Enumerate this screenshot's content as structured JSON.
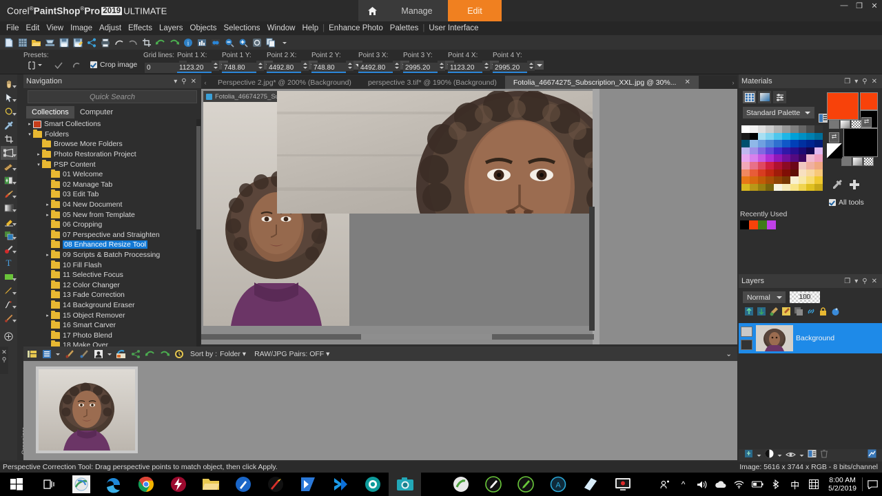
{
  "app": {
    "brand_prefix": "Corel",
    "brand_main": "PaintShop",
    "brand_pro": "Pro",
    "brand_year": "2019",
    "brand_edition": "ULTIMATE"
  },
  "top_tabs": [
    {
      "name": "home",
      "label": "⌂"
    },
    {
      "name": "manage",
      "label": "Manage"
    },
    {
      "name": "edit",
      "label": "Edit"
    }
  ],
  "window_controls": [
    "—",
    "❐",
    "✕"
  ],
  "menubar": {
    "items": [
      "File",
      "Edit",
      "View",
      "Image",
      "Adjust",
      "Effects",
      "Layers",
      "Objects",
      "Selections",
      "Window",
      "Help"
    ],
    "items2": [
      "Enhance Photo",
      "Palettes"
    ],
    "items3": [
      "User Interface"
    ]
  },
  "toolbar_icons": [
    "new-image-icon",
    "new-from-template-icon",
    "open-icon",
    "scanner-icon",
    "save-icon",
    "save-as-icon",
    "share-icon",
    "print-icon",
    "undo-icon",
    "redo-icon",
    "crop-icon",
    "rotate-left-icon",
    "rotate-right-icon",
    "info-icon",
    "histogram-icon",
    "color-icon",
    "zoom-out-icon",
    "zoom-in-icon",
    "fit-window-icon",
    "duplicate-icon"
  ],
  "options_bar": {
    "presets_label": "Presets:",
    "crop_image_label": "Crop image",
    "crop_image_checked": true,
    "fields": [
      {
        "label": "Grid lines:",
        "value": "0",
        "underline": false
      },
      {
        "label": "Point 1 X:",
        "value": "1123.20",
        "underline": true
      },
      {
        "label": "Point 1 Y:",
        "value": "748.80",
        "underline": true
      },
      {
        "label": "Point 2 X:",
        "value": "4492.80",
        "underline": true
      },
      {
        "label": "Point 2 Y:",
        "value": "748.80",
        "underline": true
      },
      {
        "label": "Point 3 X:",
        "value": "4492.80",
        "underline": true
      },
      {
        "label": "Point 3 Y:",
        "value": "2995.20",
        "underline": true
      },
      {
        "label": "Point 4 X:",
        "value": "1123.20",
        "underline": true
      },
      {
        "label": "Point 4 Y:",
        "value": "2995.20",
        "underline": true
      }
    ]
  },
  "tools": [
    {
      "name": "pan-tool",
      "glyph": "✋",
      "selected": false,
      "arrow": true
    },
    {
      "name": "pick-tool",
      "glyph": "➤",
      "selected": false,
      "arrow": true
    },
    {
      "name": "selection-tool",
      "glyph": "⬭",
      "selected": false,
      "arrow": true
    },
    {
      "name": "dropper-tool",
      "glyph": "✒",
      "selected": false,
      "arrow": false
    },
    {
      "name": "crop-tool",
      "glyph": "⧉",
      "selected": false,
      "arrow": false
    },
    {
      "name": "perspective-correction-tool",
      "glyph": "▱",
      "selected": true,
      "arrow": true
    },
    {
      "name": "straighten-tool",
      "glyph": "╱",
      "selected": false,
      "arrow": true
    },
    {
      "name": "fill-flash-tool",
      "glyph": "◨",
      "selected": false,
      "arrow": true
    },
    {
      "name": "paint-brush-tool",
      "glyph": "✎",
      "selected": false,
      "arrow": true
    },
    {
      "name": "gradient-tool",
      "glyph": "▣",
      "selected": false,
      "arrow": true
    },
    {
      "name": "eraser-tool",
      "glyph": "▬",
      "selected": false,
      "arrow": true
    },
    {
      "name": "clone-tool",
      "glyph": "⧉",
      "selected": false,
      "arrow": true
    },
    {
      "name": "retouch-tool",
      "glyph": "●",
      "selected": false,
      "arrow": true
    },
    {
      "name": "text-tool",
      "glyph": "T",
      "selected": false,
      "arrow": false
    },
    {
      "name": "shape-tool",
      "glyph": "▬",
      "selected": false,
      "arrow": true
    },
    {
      "name": "pen-tool",
      "glyph": "✐",
      "selected": false,
      "arrow": true
    },
    {
      "name": "warp-brush-tool",
      "glyph": "⌇",
      "selected": false,
      "arrow": true
    },
    {
      "name": "mesh-warp-tool",
      "glyph": "⌘",
      "selected": false,
      "arrow": true
    }
  ],
  "navigation_panel": {
    "title": "Navigation",
    "search_placeholder": "Quick Search",
    "tabs": [
      {
        "label": "Collections",
        "active": true
      },
      {
        "label": "Computer",
        "active": false
      }
    ],
    "tree": [
      {
        "label": "Smart Collections",
        "indent": 0,
        "expander": "▸",
        "type": "smart"
      },
      {
        "label": "Folders",
        "indent": 0,
        "expander": "▾",
        "type": "folder"
      },
      {
        "label": "Browse More Folders",
        "indent": 1,
        "expander": "",
        "type": "folder"
      },
      {
        "label": "Photo Restoration Project",
        "indent": 1,
        "expander": "▸",
        "type": "folder"
      },
      {
        "label": "PSP Content",
        "indent": 1,
        "expander": "▾",
        "type": "folder"
      },
      {
        "label": "01 Welcome",
        "indent": 2,
        "expander": "",
        "type": "folder"
      },
      {
        "label": "02 Manage Tab",
        "indent": 2,
        "expander": "",
        "type": "folder"
      },
      {
        "label": "03 Edit Tab",
        "indent": 2,
        "expander": "",
        "type": "folder"
      },
      {
        "label": "04 New Document",
        "indent": 2,
        "expander": "▸",
        "type": "folder"
      },
      {
        "label": "05 New from Template",
        "indent": 2,
        "expander": "▸",
        "type": "folder"
      },
      {
        "label": "06 Cropping",
        "indent": 2,
        "expander": "",
        "type": "folder"
      },
      {
        "label": "07 Perspective and Straighten",
        "indent": 2,
        "expander": "",
        "type": "folder"
      },
      {
        "label": "08 Enhanced Resize Tool",
        "indent": 2,
        "expander": "",
        "type": "folder",
        "selected": true
      },
      {
        "label": "09 Scripts & Batch Processing",
        "indent": 2,
        "expander": "▸",
        "type": "folder"
      },
      {
        "label": "10 Fill Flash",
        "indent": 2,
        "expander": "",
        "type": "folder"
      },
      {
        "label": "11 Selective Focus",
        "indent": 2,
        "expander": "",
        "type": "folder"
      },
      {
        "label": "12 Color Changer",
        "indent": 2,
        "expander": "",
        "type": "folder"
      },
      {
        "label": "13 Fade Correction",
        "indent": 2,
        "expander": "",
        "type": "folder"
      },
      {
        "label": "14 Background Eraser",
        "indent": 2,
        "expander": "",
        "type": "folder"
      },
      {
        "label": "15 Object Remover",
        "indent": 2,
        "expander": "▸",
        "type": "folder"
      },
      {
        "label": "16 Smart Carver",
        "indent": 2,
        "expander": "",
        "type": "folder"
      },
      {
        "label": "17 Photo Blend",
        "indent": 2,
        "expander": "",
        "type": "folder"
      },
      {
        "label": "18 Make Over",
        "indent": 2,
        "expander": "",
        "type": "folder"
      }
    ]
  },
  "document_tabs": [
    {
      "label": "Perspective 2.jpg* @ 200% (Background)",
      "active": false
    },
    {
      "label": "perspective 3.tif* @ 190% (Background)",
      "active": false
    },
    {
      "label": "Fotolia_46674275_Subscription_XXL.jpg @  30%...",
      "active": true,
      "close": "✕"
    }
  ],
  "image_window": {
    "title": "Fotolia_46674275_Su"
  },
  "organizer": {
    "sort_by_label": "Sort by :",
    "sort_by_value": "Folder",
    "raw_jpg_label": "RAW/JPG Pairs: OFF",
    "vertical_label": "Organizer",
    "icons": [
      "folder-view-icon",
      "list-view-icon",
      "tag-icon",
      "tag-remove-icon",
      "people-icon",
      "places-icon",
      "share-icon",
      "rotate-left-icon",
      "rotate-right-icon",
      "recent-icon"
    ]
  },
  "materials_panel": {
    "title": "Materials",
    "header_icons": [
      "restore-icon",
      "chevron-down-icon",
      "pin-icon",
      "close-icon"
    ],
    "mode_buttons": [
      "palette-mode-icon",
      "gradient-mode-icon",
      "sliders-mode-icon"
    ],
    "palette_label": "Standard Palette",
    "all_tools_label": "All tools",
    "all_tools_checked": true,
    "recently_used_label": "Recently Used",
    "recently_used_colors": [
      "#000000",
      "#f8420a",
      "#3f7a18",
      "#c040e8"
    ],
    "foreground_color": "#f8420a",
    "background_color": "#000000"
  },
  "layers_panel": {
    "title": "Layers",
    "header_icons": [
      "restore-icon",
      "chevron-down-icon",
      "pin-icon",
      "close-icon"
    ],
    "blend_mode": "Normal",
    "opacity": "100",
    "tool_icons": [
      "new-raster-layer-icon",
      "new-vector-layer-icon",
      "new-art-media-icon",
      "new-mask-layer-icon",
      "merge-icon",
      "link-icon",
      "lock-icon",
      "effects-icon"
    ],
    "layer": {
      "name": "Background",
      "selected": true
    },
    "footer_icons": [
      "new-layer-icon",
      "mask-icon",
      "visibility-icon",
      "properties-icon",
      "delete-icon",
      "settings-icon"
    ]
  },
  "status_bar": {
    "message": "Perspective Correction Tool: Drag perspective points to match object, then click Apply.",
    "image_info": "Image: 5616 x 3744 x RGB - 8 bits/channel"
  },
  "taskbar": {
    "items": [
      {
        "name": "start-button"
      },
      {
        "name": "task-view-button"
      },
      {
        "name": "paintshop-pro-taskbar-icon",
        "active": false,
        "underline": false
      },
      {
        "name": "edge-taskbar-icon",
        "underline": false
      },
      {
        "name": "chrome-taskbar-icon",
        "underline": true
      },
      {
        "name": "flash-taskbar-icon",
        "underline": false
      },
      {
        "name": "file-explorer-taskbar-icon",
        "underline": true
      },
      {
        "name": "corel-draw-taskbar-icon",
        "underline": false
      },
      {
        "name": "corel-photo-paint-taskbar-icon",
        "underline": false
      },
      {
        "name": "powershell-taskbar-icon",
        "underline": false
      },
      {
        "name": "terminal-taskbar-icon",
        "underline": false
      },
      {
        "name": "camtasia-taskbar-icon",
        "underline": false
      },
      {
        "name": "camera-taskbar-icon",
        "active": true,
        "underline": false
      },
      {
        "name": "aftershot-taskbar-icon",
        "underline": false
      },
      {
        "name": "painter-taskbar-icon",
        "underline": false
      },
      {
        "name": "painter-essentials-taskbar-icon",
        "underline": false
      },
      {
        "name": "aftereffects-taskbar-icon",
        "underline": false
      },
      {
        "name": "notebook-taskbar-icon",
        "underline": true
      },
      {
        "name": "screen-recorder-taskbar-icon",
        "underline": true
      }
    ],
    "tray_icons": [
      "show-hidden-icons",
      "volume-icon",
      "onedrive-icon",
      "network-icon",
      "battery-icon",
      "bluetooth-icon",
      "ime-icon",
      "ime-mode-icon"
    ],
    "people_icon": "people-icon",
    "clock_time": "8:00 AM",
    "clock_date": "5/2/2019",
    "action_center": "notification-icon"
  },
  "colors": {
    "accent_orange": "#f08020",
    "selection_blue": "#1278d4",
    "layer_blue": "#1e8ae8",
    "panel_bg": "#2e2e2e",
    "titlebar_bg": "#2b2b2b",
    "canvas_bg": "#8c8c8c"
  }
}
